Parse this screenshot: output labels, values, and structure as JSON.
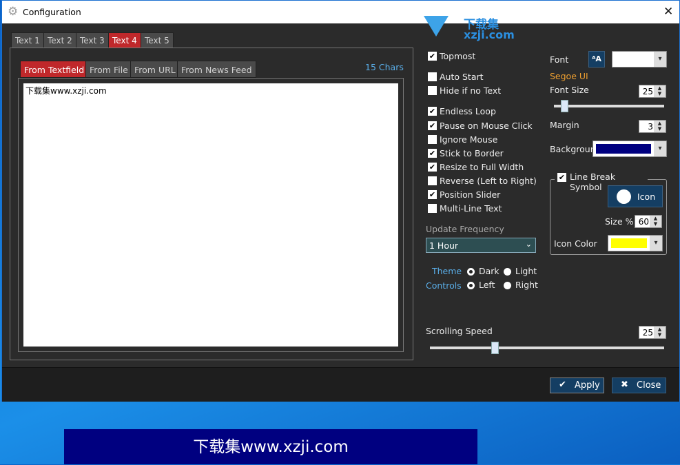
{
  "window": {
    "title": "Configuration",
    "icon": "gear-icon",
    "close_icon": "close-icon"
  },
  "watermark": {
    "logo_text": "下载集 xzji.com"
  },
  "text_tabs": [
    {
      "label": "Text 1"
    },
    {
      "label": "Text 2"
    },
    {
      "label": "Text 3"
    },
    {
      "label": "Text 4",
      "active": true
    },
    {
      "label": "Text 5"
    }
  ],
  "source_tabs": [
    {
      "label": "From Textfield",
      "active": true
    },
    {
      "label": "From File"
    },
    {
      "label": "From URL"
    },
    {
      "label": "From News Feed"
    }
  ],
  "char_count": "15 Chars",
  "textfield_value": "下载集www.xzji.com",
  "options": [
    {
      "label": "Topmost",
      "checked": true
    },
    {
      "label": "Auto Start",
      "checked": false
    },
    {
      "label": "Hide if no Text",
      "checked": false
    },
    {
      "label": "Endless Loop",
      "checked": true
    },
    {
      "label": "Pause on Mouse Click",
      "checked": true
    },
    {
      "label": "Ignore Mouse",
      "checked": false
    },
    {
      "label": "Stick to Border",
      "checked": true
    },
    {
      "label": "Resize to Full Width",
      "checked": true
    },
    {
      "label": "Reverse (Left to Right)",
      "checked": false
    },
    {
      "label": "Position Slider",
      "checked": true
    },
    {
      "label": "Multi-Line Text",
      "checked": false
    }
  ],
  "update_frequency": {
    "label": "Update Frequency",
    "value": "1 Hour"
  },
  "theme": {
    "label": "Theme",
    "options": [
      "Dark",
      "Light"
    ],
    "selected": "Dark"
  },
  "controls": {
    "label": "Controls",
    "options": [
      "Left",
      "Right"
    ],
    "selected": "Left"
  },
  "font": {
    "label": "Font",
    "name": "Segoe UI",
    "color": "#ffffff"
  },
  "font_size": {
    "label": "Font Size",
    "value": "25",
    "slider_fraction": 0.07
  },
  "margin": {
    "label": "Margin",
    "value": "3"
  },
  "background": {
    "label": "Background",
    "color": "#000080"
  },
  "line_break": {
    "label": "Line Break Symbol",
    "checked": true,
    "icon_button": "Icon",
    "size_label": "Size %",
    "size_value": "60",
    "color_label": "Icon Color",
    "color": "#ffff00"
  },
  "scrolling_speed": {
    "label": "Scrolling Speed",
    "value": "25",
    "slider_fraction": 0.27
  },
  "buttons": {
    "apply": "Apply",
    "close": "Close"
  },
  "banner": {
    "text": "下载集www.xzji.com",
    "background": "#000080"
  }
}
